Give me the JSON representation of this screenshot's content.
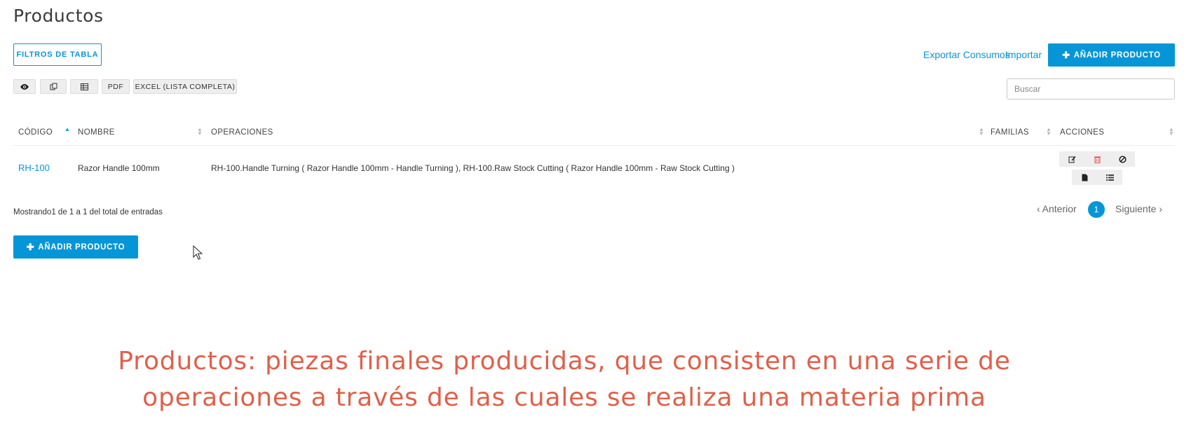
{
  "page": {
    "title": "Productos"
  },
  "toolbar": {
    "filters_label": "FILTROS DE TABLA",
    "export_link": "Exportar Consumos",
    "import_link": "Importar",
    "add_product_label": "AÑADIR PRODUCTO",
    "pdf_label": "PDF",
    "excel_label": "EXCEL (LISTA COMPLETA)"
  },
  "icons": {
    "visibility": "eye-icon",
    "copy": "copy-icon",
    "csv": "table-icon",
    "edit": "edit-icon",
    "delete": "trash-icon",
    "disable": "ban-icon",
    "document": "file-icon",
    "list": "list-icon"
  },
  "search": {
    "placeholder": "Buscar",
    "value": ""
  },
  "table": {
    "columns": [
      "CÓDIGO",
      "NOMBRE",
      "OPERACIONES",
      "FAMILIAS",
      "ACCIONES"
    ],
    "sorted_column": "CÓDIGO",
    "sort_direction": "asc",
    "rows": [
      {
        "code": "RH-100",
        "name": "Razor Handle 100mm",
        "operations": "RH-100.Handle Turning ( Razor Handle 100mm - Handle Turning ), RH-100.Raw Stock Cutting ( Razor Handle 100mm - Raw Stock Cutting )",
        "families": ""
      }
    ]
  },
  "footer": {
    "info": "Mostrando1 de 1 a 1 del total de entradas",
    "prev_label": "Anterior",
    "next_label": "Siguiente",
    "current_page": "1",
    "add_product_label": "AÑADIR PRODUCTO"
  },
  "caption": {
    "line1": "Productos: piezas finales producidas, que consisten en una serie de",
    "line2": "operaciones a través de las cuales se realiza una materia prima"
  },
  "colors": {
    "accent": "#0696d7",
    "danger": "#e0504a",
    "caption": "#e0604a"
  }
}
